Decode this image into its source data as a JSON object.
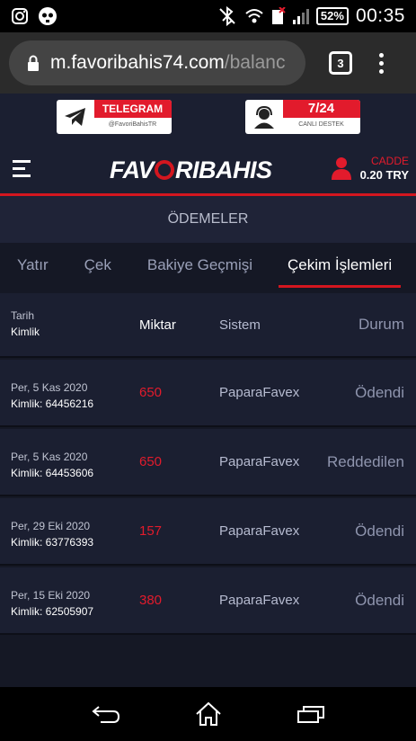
{
  "status_bar": {
    "battery": "52%",
    "time": "00:35",
    "icons": [
      "instagram-icon",
      "skull-icon",
      "bluetooth-off-icon",
      "wifi-icon",
      "sim-icon",
      "signal-icon"
    ]
  },
  "browser": {
    "url_main": "m.favoribahis74.com",
    "url_rest": "/balanc",
    "tab_count": "3"
  },
  "banners": {
    "telegram": {
      "title": "TELEGRAM",
      "sub": "@FavoriBahisTR"
    },
    "support": {
      "title": "7/24",
      "sub": "CANLI DESTEK"
    }
  },
  "header": {
    "logo_pre": "FAV",
    "logo_post": "RIBAHIS",
    "user_name": "CADDE",
    "balance": "0.20 TRY"
  },
  "page_title": "ÖDEMELER",
  "tabs": [
    {
      "label": "Yatır"
    },
    {
      "label": "Çek"
    },
    {
      "label": "Bakiye Geçmişi"
    },
    {
      "label": "Çekim İşlemleri",
      "active": true
    }
  ],
  "table": {
    "headers": {
      "date": "Tarih",
      "id": "Kimlik",
      "amount": "Miktar",
      "system": "Sistem",
      "status": "Durum"
    },
    "rows": [
      {
        "date": "Per, 5 Kas 2020",
        "id": "Kimlik: 64456216",
        "amount": "650",
        "system": "PaparaFavex",
        "status": "Ödendi"
      },
      {
        "date": "Per, 5 Kas 2020",
        "id": "Kimlik: 64453606",
        "amount": "650",
        "system": "PaparaFavex",
        "status": "Reddedilen"
      },
      {
        "date": "Per, 29 Eki 2020",
        "id": "Kimlik: 63776393",
        "amount": "157",
        "system": "PaparaFavex",
        "status": "Ödendi"
      },
      {
        "date": "Per, 15 Eki 2020",
        "id": "Kimlik: 62505907",
        "amount": "380",
        "system": "PaparaFavex",
        "status": "Ödendi"
      }
    ]
  },
  "colors": {
    "accent": "#d3161f",
    "background": "#151825",
    "panel": "#1b1f31"
  }
}
